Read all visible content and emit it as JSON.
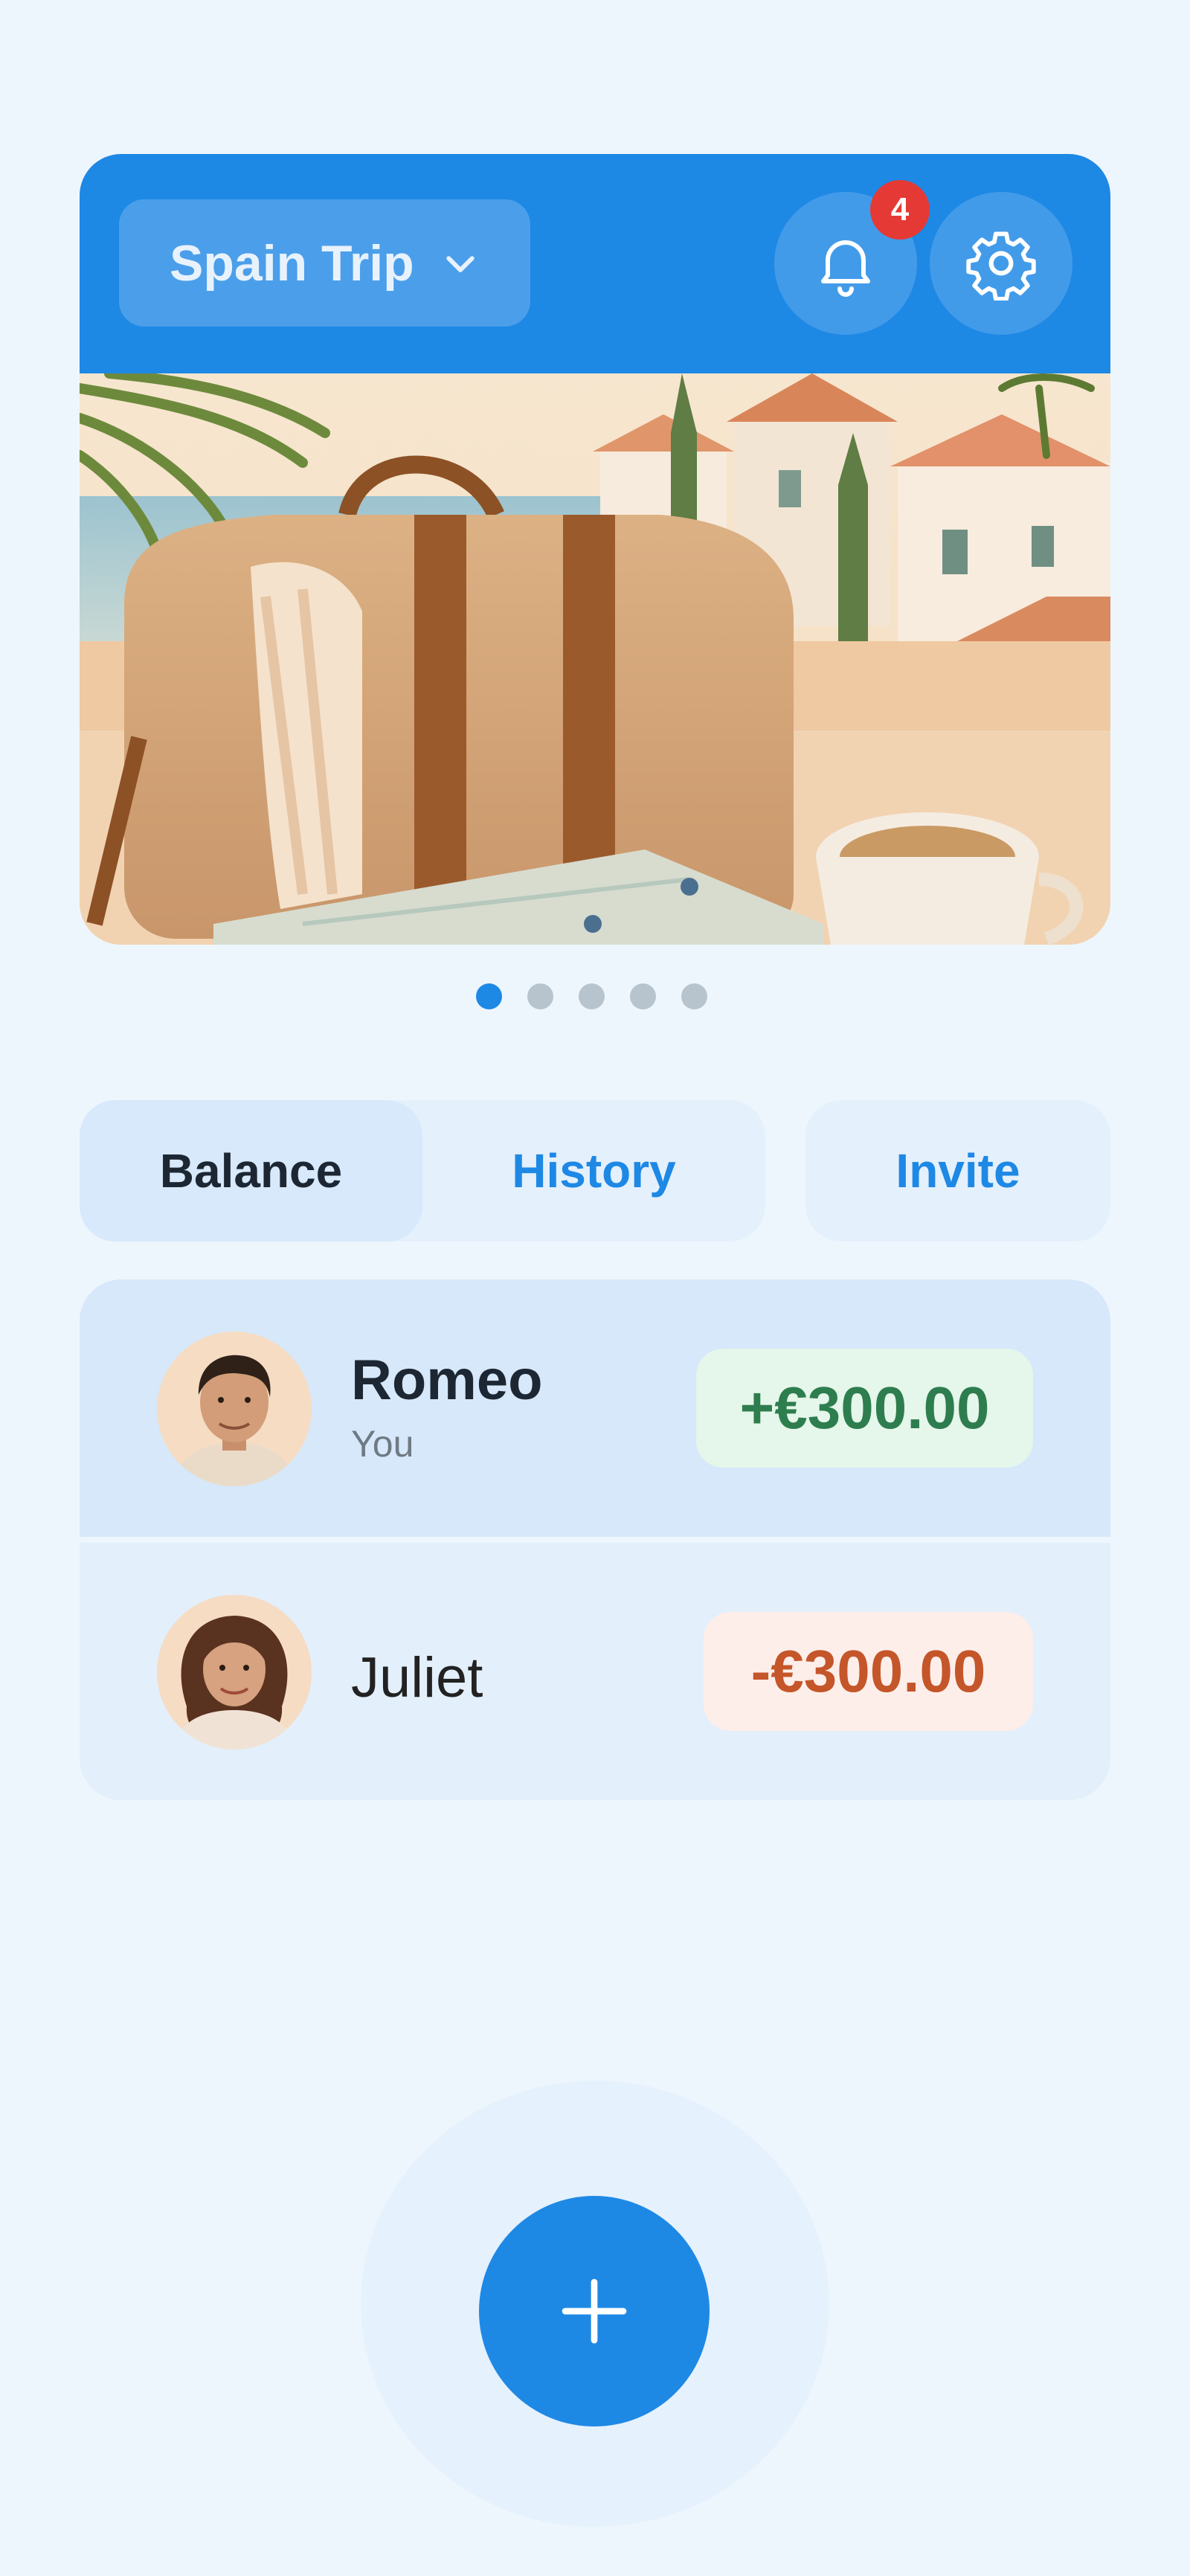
{
  "header": {
    "trip_name": "Spain Trip",
    "notification_count": "4",
    "accent_color": "#1e88e5"
  },
  "carousel": {
    "slide_count": 5,
    "active_index": 0
  },
  "tabs": [
    {
      "label": "Balance",
      "active": true
    },
    {
      "label": "History",
      "active": false
    }
  ],
  "invite_label": "Invite",
  "balances": [
    {
      "name": "Romeo",
      "subtitle": "You",
      "amount": "+€300.00",
      "status": "positive"
    },
    {
      "name": "Juliet",
      "subtitle": "",
      "amount": "-€300.00",
      "status": "negative"
    }
  ],
  "icons": {
    "trip": "chevron-down-icon",
    "notifications": "bell-icon",
    "settings": "gear-icon",
    "fab": "plus-icon"
  }
}
